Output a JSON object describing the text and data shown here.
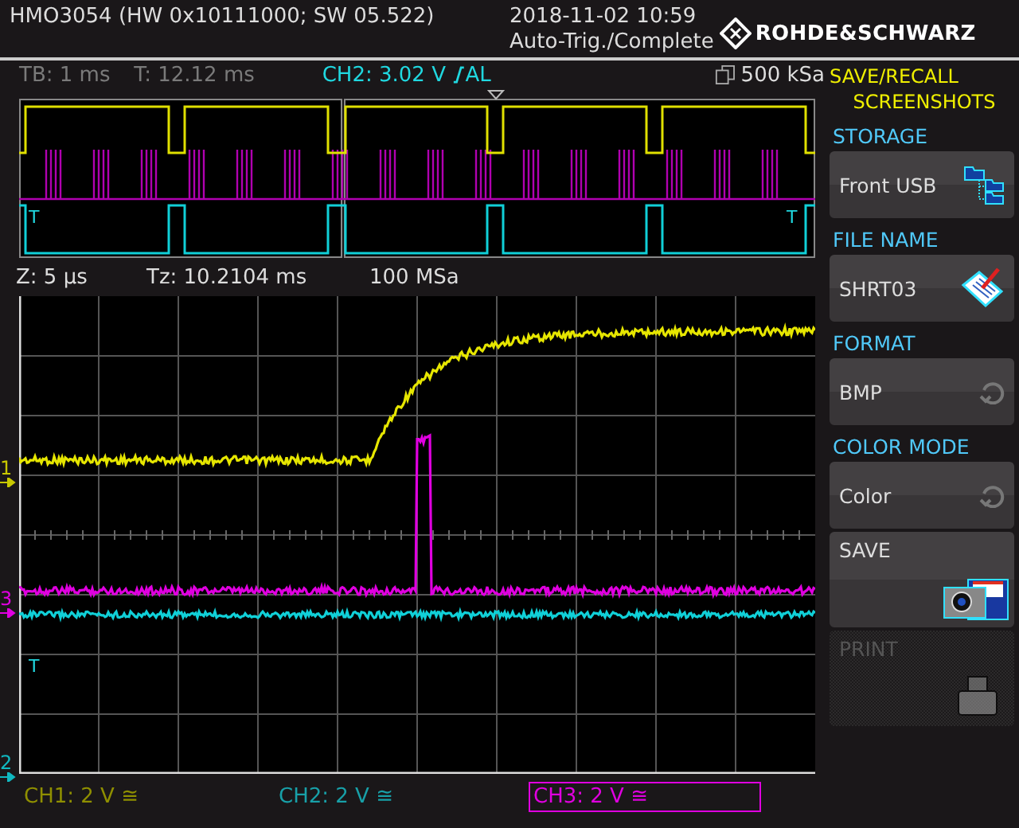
{
  "header": {
    "title": "HMO3054 (HW 0x10111000; SW 05.522)",
    "datetime": "2018-11-02 10:59",
    "status": "Auto-Trig./Complete",
    "brand": "ROHDE&SCHWARZ"
  },
  "info_bar": {
    "timebase": "TB: 1 ms",
    "time": "T: 12.12 ms",
    "trigger_level": "CH2: 3.02 V",
    "trigger_mode": "AL",
    "sample_memory": "500 kSa"
  },
  "overview": {
    "trigger_markers": [
      "T",
      "T"
    ]
  },
  "zoom_bar": {
    "zoom": "Z: 5 µs",
    "zoom_time": "Tz: 10.2104 ms",
    "sample_rate": "100 MSa"
  },
  "grid": {
    "channel_markers": [
      {
        "label": "1",
        "color": "#c8c800"
      },
      {
        "label": "3",
        "color": "#e000e0"
      },
      {
        "label": "2",
        "color": "#10b8c0"
      }
    ],
    "trigger_marker": "T"
  },
  "channels": [
    {
      "label": "CH1: 2 V ≅",
      "color": "#8f8f00",
      "selected": false
    },
    {
      "label": "CH2: 2 V ≅",
      "color": "#18a0a8",
      "selected": false
    },
    {
      "label": "CH3: 2 V ≅",
      "color": "#e000e0",
      "selected": true
    }
  ],
  "menu": {
    "title": [
      "SAVE/RECALL",
      "SCREENSHOTS"
    ],
    "items": [
      {
        "kind": "storage",
        "label": "STORAGE",
        "value": "Front USB",
        "disabled": false
      },
      {
        "kind": "filename",
        "label": "FILE NAME",
        "value": "SHRT03",
        "disabled": false
      },
      {
        "kind": "cycle",
        "label": "FORMAT",
        "value": "BMP",
        "disabled": false
      },
      {
        "kind": "cycle",
        "label": "COLOR MODE",
        "value": "Color",
        "disabled": false
      },
      {
        "kind": "save",
        "value": "SAVE",
        "disabled": false
      },
      {
        "kind": "print",
        "value": "PRINT",
        "disabled": true
      }
    ]
  }
}
